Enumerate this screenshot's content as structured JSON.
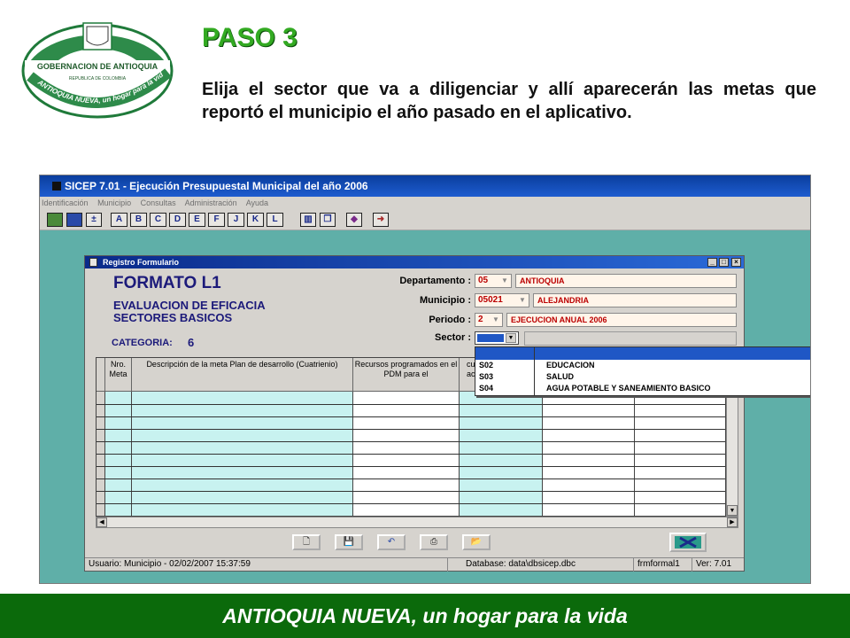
{
  "logo": {
    "name": "GOBERNACION DE ANTIOQUIA",
    "subtitle": "REPUBLICA DE COLOMBIA",
    "slogan": "ANTIOQUIA NUEVA, un hogar para la vida"
  },
  "heading": "PASO 3",
  "instruction": "Elija el sector que va a diligenciar y allí aparecerán las metas que reportó el municipio el año pasado en el aplicativo.",
  "app": {
    "title": "SICEP 7.01 - Ejecución Presupuestal Municipal del año 2006",
    "menu": [
      "Identificación",
      "Municipio",
      "Consultas",
      "Administración",
      "Ayuda"
    ],
    "toolbar_letters": [
      "A",
      "B",
      "C",
      "D",
      "E",
      "F",
      "J",
      "K",
      "L"
    ]
  },
  "form": {
    "window_title": "Registro Formulario",
    "title": "FORMATO L1",
    "subtitle1": "EVALUACION DE EFICACIA",
    "subtitle2": "SECTORES BASICOS",
    "category_label": "CATEGORIA:",
    "category_value": "6",
    "departamento_label": "Departamento :",
    "departamento_code": "05",
    "departamento_name": "ANTIOQUIA",
    "municipio_label": "Municipio :",
    "municipio_code": "05021",
    "municipio_name": "ALEJANDRIA",
    "periodo_label": "Periodo :",
    "periodo_code": "2",
    "periodo_name": "EJECUCION ANUAL 2006",
    "sector_label": "Sector :"
  },
  "grid": {
    "col1": "Nro. Meta",
    "col2": "Descripción de la meta Plan de desarrollo (Cuatrienio)",
    "col3": "Recursos programados en el PDM para el",
    "col4": "cur acu"
  },
  "sector_options": [
    {
      "code": "S02",
      "name": "EDUCACION"
    },
    {
      "code": "S03",
      "name": "SALUD"
    },
    {
      "code": "S04",
      "name": "AGUA POTABLE Y SANEAMIENTO BASICO"
    }
  ],
  "status": {
    "user": "Usuario: Municipio - 02/02/2007 15:37:59",
    "database": "Database: data\\dbsicep.dbc",
    "form": "frmformal1",
    "version": "Ver: 7.01"
  },
  "footer": "ANTIOQUIA NUEVA, un hogar para la vida",
  "colors": {
    "accent_green": "#33aa22",
    "footer_green": "#0b6a0b",
    "app_bg": "#5fafa8"
  }
}
